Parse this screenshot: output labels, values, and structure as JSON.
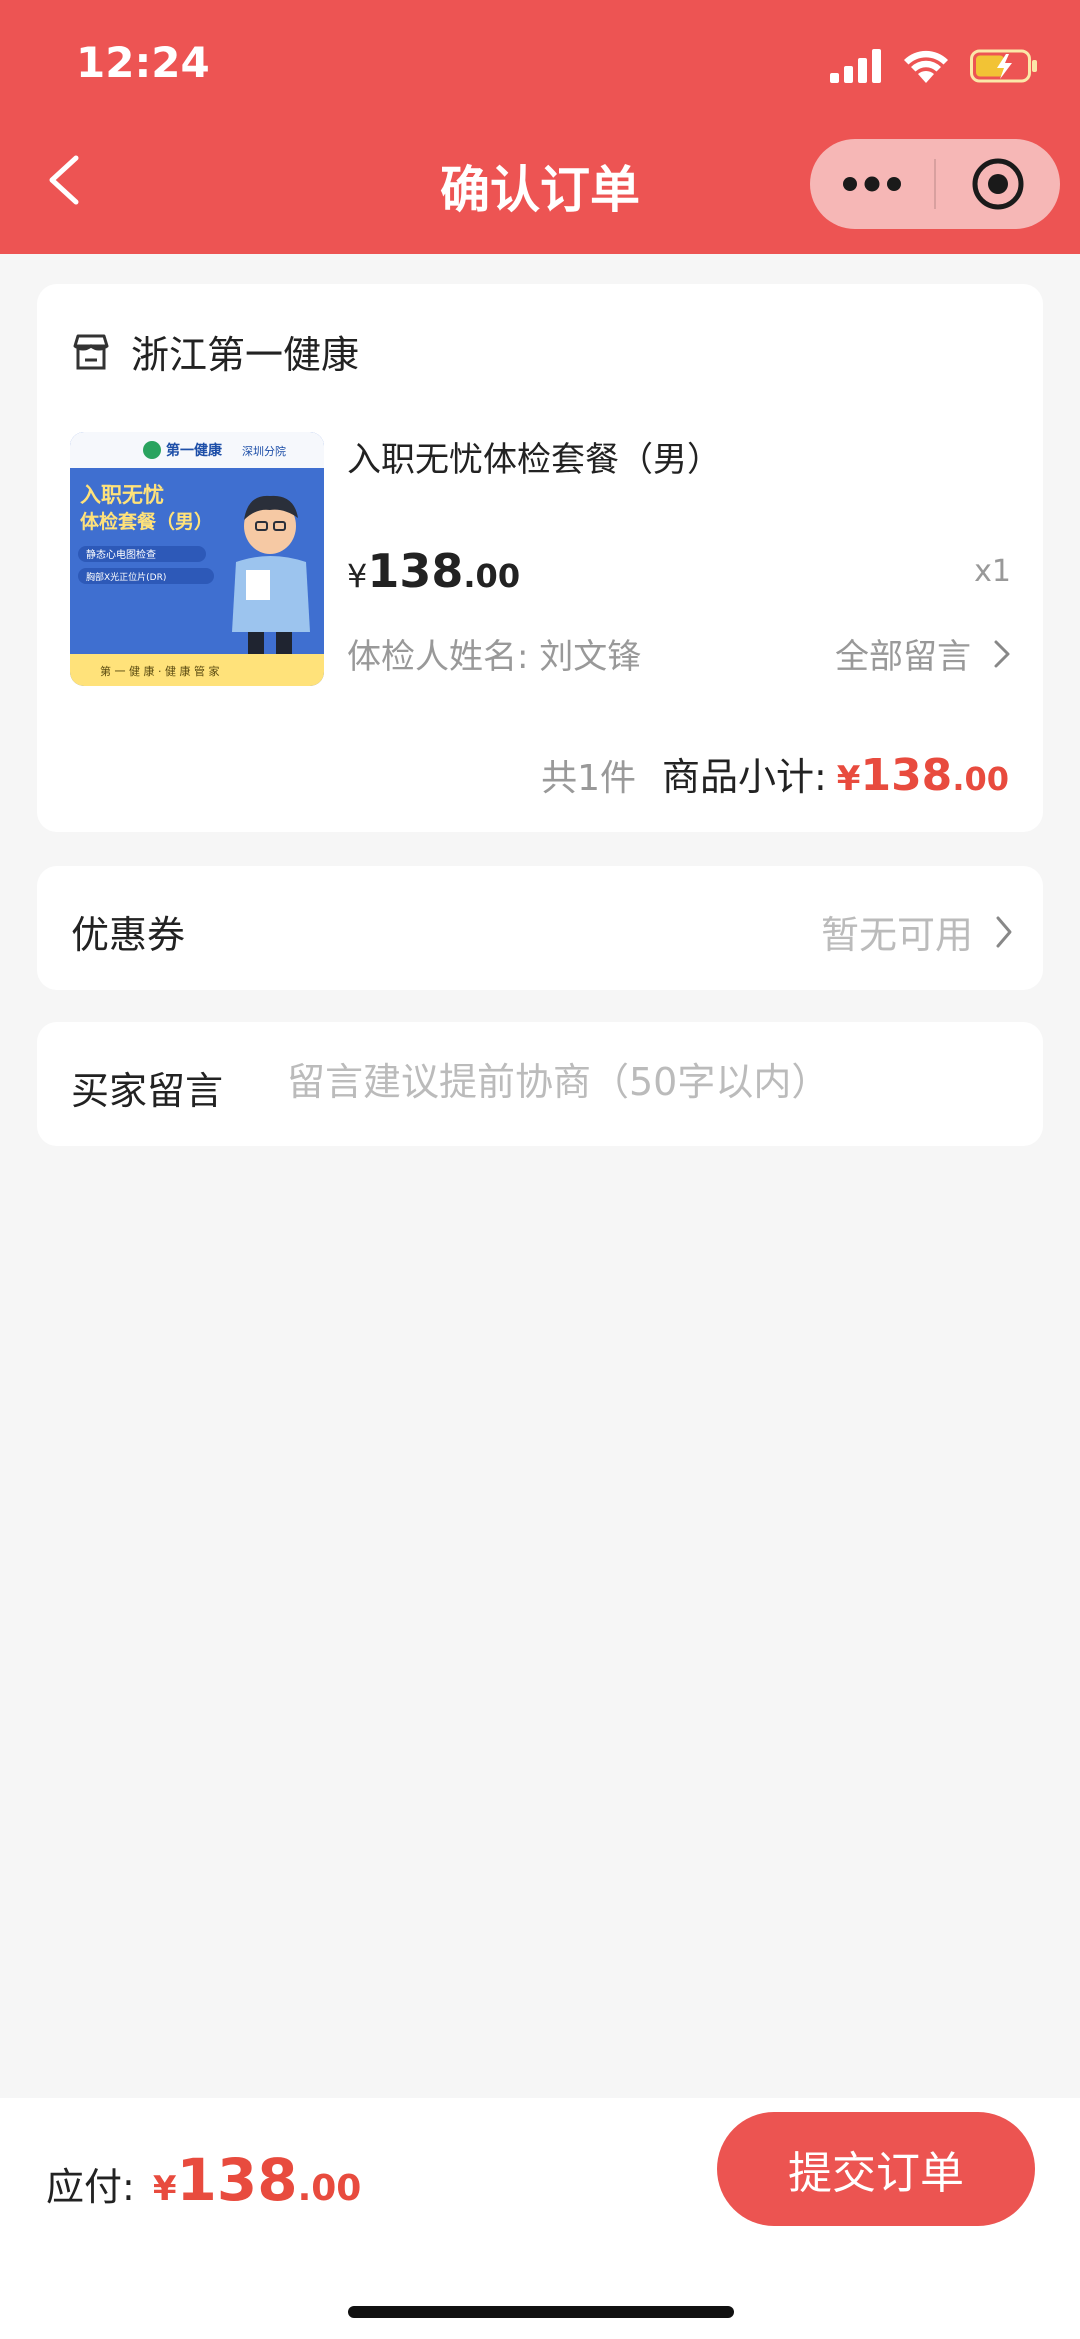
{
  "status_bar": {
    "time": "12:24",
    "icons": [
      "signal-icon",
      "wifi-icon",
      "battery-charging-icon"
    ]
  },
  "nav": {
    "title": "确认订单",
    "back_icon": "chevron-left-icon",
    "more_icon": "more-dots-icon",
    "close_icon": "target-circle-icon",
    "bar_color": "#ed5453"
  },
  "store": {
    "icon": "store-icon",
    "name": "浙江第一健康"
  },
  "product": {
    "image_texts": {
      "brand": "第一健康",
      "branch": "深圳分院",
      "headline_1": "入职无忧",
      "headline_2": "体检套餐（男）",
      "item_1": "静态心电图检查",
      "item_2": "胸部X光正位片(DR)",
      "footer": "第 一 健 康 · 健 康 管 家"
    },
    "title": "入职无忧体检套餐（男）",
    "price_symbol": "¥",
    "price_int": "138",
    "price_dec": ".00",
    "quantity": "x1",
    "examinee": "体检人姓名: 刘文锋",
    "all_messages": "全部留言"
  },
  "subtotal": {
    "count": "共1件",
    "label": "商品小计:",
    "symbol": "¥",
    "int": "138",
    "dec": ".00"
  },
  "coupon": {
    "label": "优惠券",
    "value": "暂无可用"
  },
  "message": {
    "label": "买家留言",
    "placeholder": "留言建议提前协商（50字以内）"
  },
  "footer": {
    "pay_label": "应付:",
    "symbol": "¥",
    "int": "138",
    "dec": ".00",
    "submit": "提交订单",
    "accent": "#e84b3e"
  }
}
